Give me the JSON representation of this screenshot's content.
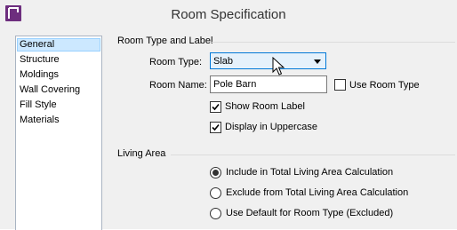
{
  "window": {
    "title": "Room Specification"
  },
  "sidebar": {
    "items": [
      {
        "label": "General",
        "selected": true
      },
      {
        "label": "Structure"
      },
      {
        "label": "Moldings"
      },
      {
        "label": "Wall Covering"
      },
      {
        "label": "Fill Style"
      },
      {
        "label": "Materials"
      }
    ]
  },
  "room_type_group": {
    "heading": "Room Type and Label",
    "room_type_label": "Room Type:",
    "room_type_value": "Slab",
    "room_name_label": "Room Name:",
    "room_name_value": "Pole Barn",
    "use_room_type": {
      "label": "Use Room Type",
      "checked": false
    },
    "show_room_label": {
      "label": "Show Room Label",
      "checked": true
    },
    "display_uppercase": {
      "label": "Display in Uppercase",
      "checked": true
    }
  },
  "living_area_group": {
    "heading": "Living Area",
    "options": [
      {
        "label": "Include in Total Living Area Calculation",
        "selected": true
      },
      {
        "label": "Exclude from Total Living Area Calculation",
        "selected": false
      },
      {
        "label": "Use Default for Room Type (Excluded)",
        "selected": false
      }
    ]
  },
  "colors": {
    "accent": "#0078d7",
    "selection": "#cce8ff",
    "app_icon": "#6d2e7e"
  }
}
